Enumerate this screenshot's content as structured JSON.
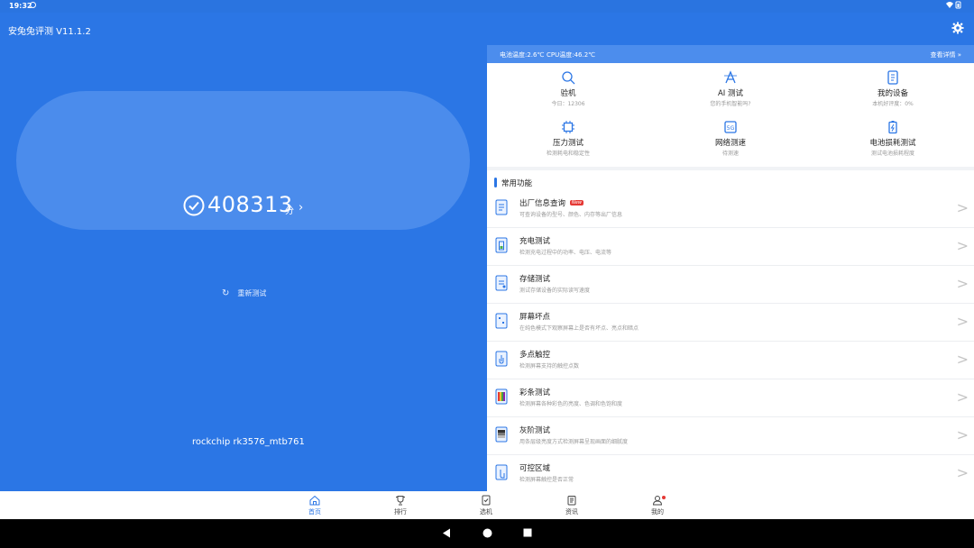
{
  "status_bar": {
    "time": "19:32",
    "right_icons": "wifi-icon, battery-icon"
  },
  "app": {
    "title": "安兔兔评测 V11.1.2"
  },
  "score": {
    "value": "408313",
    "unit": "分",
    "chevron": "›"
  },
  "retest": {
    "label": "重新测试"
  },
  "device": {
    "name": "rockchip rk3576_mtb761"
  },
  "temps": {
    "battery": "电池温度:2.6℃",
    "cpu": "CPU温度:46.2℃",
    "more": "查看详情 »"
  },
  "grid": [
    {
      "label": "验机",
      "sub": "今日：12306",
      "icon": "search-icon"
    },
    {
      "label": "AI 测试",
      "sub": "您的手机智能吗?",
      "icon": "ai-icon"
    },
    {
      "label": "我的设备",
      "sub": "本机好评度：0%",
      "icon": "device-info-icon"
    },
    {
      "label": "压力测试",
      "sub": "检测耗电和稳定性",
      "icon": "chip-icon"
    },
    {
      "label": "网络测速",
      "sub": "待测速",
      "icon": "network-5g-icon"
    },
    {
      "label": "电池损耗测试",
      "sub": "测试电池损耗程度",
      "icon": "battery-test-icon"
    }
  ],
  "section": {
    "title": "常用功能"
  },
  "features": [
    {
      "title": "出厂信息查询",
      "sub": "可查询设备的型号、颜色、内存等出厂信息",
      "badge": "New",
      "icon": "factory-info-icon"
    },
    {
      "title": "充电测试",
      "sub": "检测充电过程中的功率、电压、电流等",
      "icon": "charging-icon"
    },
    {
      "title": "存储测试",
      "sub": "测试存储设备的实际读写速度",
      "icon": "storage-icon"
    },
    {
      "title": "屏幕坏点",
      "sub": "在纯色模式下观察屏幕上是否有坏点、亮点和暗点",
      "icon": "dead-pixel-icon"
    },
    {
      "title": "多点触控",
      "sub": "检测屏幕支持的触控点数",
      "icon": "multitouch-icon"
    },
    {
      "title": "彩条测试",
      "sub": "检测屏幕各种彩色的亮度、色调和色饱和度",
      "icon": "color-bar-icon"
    },
    {
      "title": "灰阶测试",
      "sub": "用条层级亮度方式检测屏幕呈现画面的细腻度",
      "icon": "grayscale-icon"
    },
    {
      "title": "可控区域",
      "sub": "检测屏幕触控是否正常",
      "icon": "touch-area-icon"
    }
  ],
  "nav": [
    {
      "label": "首页",
      "icon": "home-icon"
    },
    {
      "label": "排行",
      "icon": "trophy-icon"
    },
    {
      "label": "选机",
      "icon": "select-phone-icon"
    },
    {
      "label": "资讯",
      "icon": "news-icon"
    },
    {
      "label": "我的",
      "icon": "profile-icon"
    }
  ]
}
